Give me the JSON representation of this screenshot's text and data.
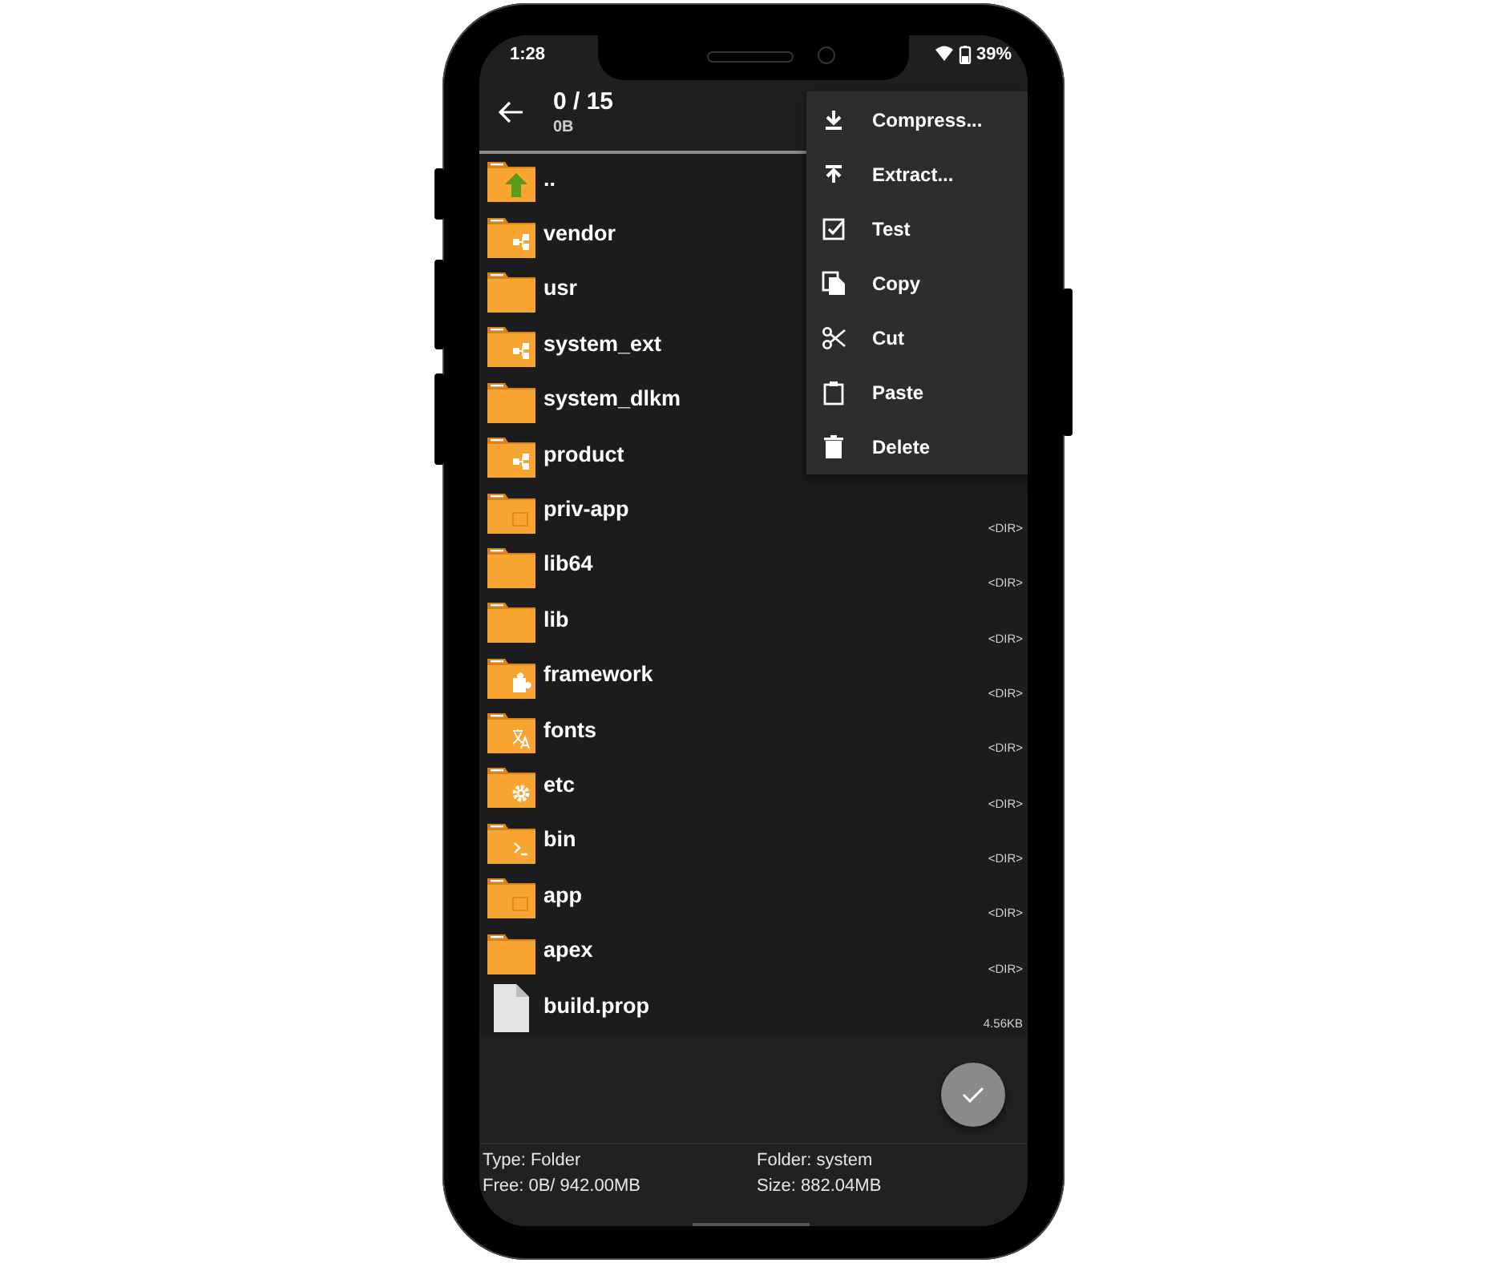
{
  "status_bar": {
    "time": "1:28",
    "battery": "39%"
  },
  "app_bar": {
    "title": "0 / 15",
    "subtitle": "0B"
  },
  "files": [
    {
      "name": "..",
      "kind": "parent"
    },
    {
      "name": "vendor",
      "kind": "link"
    },
    {
      "name": "usr",
      "kind": "folder"
    },
    {
      "name": "system_ext",
      "kind": "link"
    },
    {
      "name": "system_dlkm",
      "kind": "folder"
    },
    {
      "name": "product",
      "kind": "link"
    },
    {
      "name": "priv-app",
      "kind": "app",
      "size": "<DIR>"
    },
    {
      "name": "lib64",
      "kind": "folder",
      "size": "<DIR>"
    },
    {
      "name": "lib",
      "kind": "folder",
      "size": "<DIR>"
    },
    {
      "name": "framework",
      "kind": "plugin",
      "size": "<DIR>"
    },
    {
      "name": "fonts",
      "kind": "language",
      "size": "<DIR>"
    },
    {
      "name": "etc",
      "kind": "config",
      "size": "<DIR>"
    },
    {
      "name": "bin",
      "kind": "terminal",
      "size": "<DIR>"
    },
    {
      "name": "app",
      "kind": "app",
      "size": "<DIR>"
    },
    {
      "name": "apex",
      "kind": "folder",
      "size": "<DIR>"
    },
    {
      "name": "build.prop",
      "kind": "file",
      "size": "4.56KB"
    }
  ],
  "menu": [
    {
      "label": "Compress...",
      "kind": "compress"
    },
    {
      "label": "Extract...",
      "kind": "extract"
    },
    {
      "label": "Test",
      "kind": "test"
    },
    {
      "label": "Copy",
      "kind": "copy"
    },
    {
      "label": "Cut",
      "kind": "cut"
    },
    {
      "label": "Paste",
      "kind": "paste"
    },
    {
      "label": "Delete",
      "kind": "delete"
    }
  ],
  "footer": {
    "type": "Type: Folder",
    "folder": "Folder: system",
    "free": "Free: 0B/ 942.00MB",
    "size": "Size: 882.04MB"
  }
}
